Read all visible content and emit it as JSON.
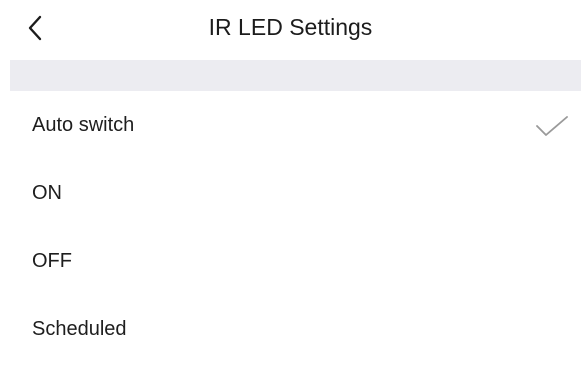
{
  "header": {
    "title": "IR LED Settings",
    "back_icon": "chevron-left-icon"
  },
  "options": [
    {
      "label": "Auto switch",
      "selected": true
    },
    {
      "label": "ON",
      "selected": false
    },
    {
      "label": "OFF",
      "selected": false
    },
    {
      "label": "Scheduled",
      "selected": false
    }
  ],
  "colors": {
    "section_gap": "#ececf1",
    "check": "#9a9a9a",
    "text": "#1e1e1e"
  }
}
